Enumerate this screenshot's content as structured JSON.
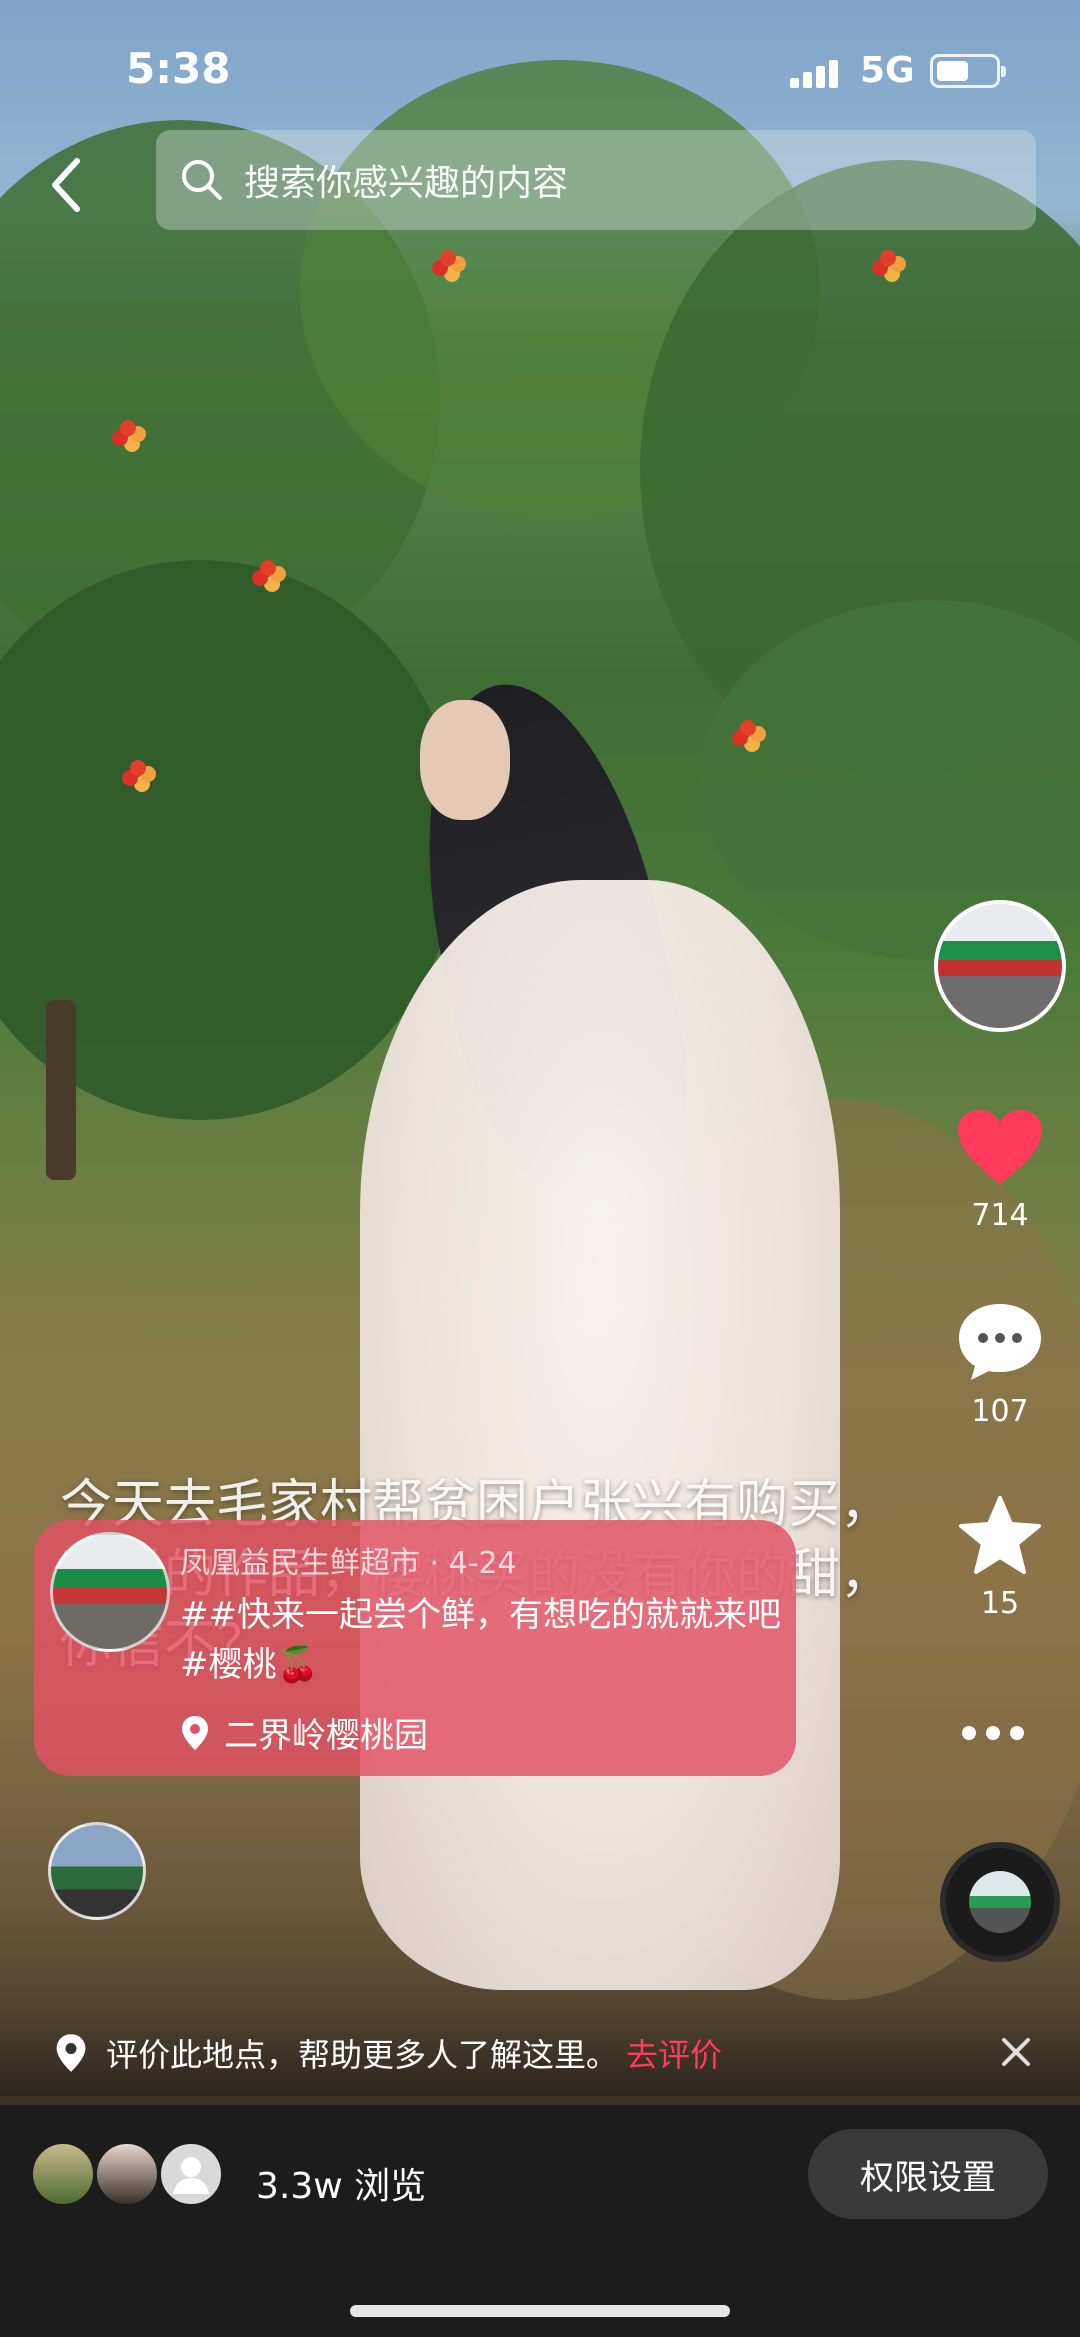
{
  "status_bar": {
    "time": "5:38",
    "network": "5G",
    "battery_level": 0.55,
    "signal_bars": 4
  },
  "search": {
    "placeholder": "搜索你感兴趣的内容",
    "icon": "search-icon"
  },
  "video": {
    "overlay_caption": "今天去毛家村帮贫困户张兴有购买，附赠的作品，樱桃买的没有你的甜，你信不？"
  },
  "card": {
    "author": "凤凰益民生鲜超市 · 4-24",
    "text": "##快来一起尝个鲜，有想吃的就就来吧 #樱桃🍒",
    "location": "二界岭樱桃园"
  },
  "actions": {
    "likes": "714",
    "comments": "107",
    "favorites": "15"
  },
  "review_prompt": {
    "text": "评价此地点，帮助更多人了解这里。",
    "link": "去评价"
  },
  "bottom": {
    "views": "3.3w 浏览",
    "permission_button": "权限设置"
  },
  "colors": {
    "like": "#ff3b5c",
    "card_bg": "#e25064",
    "bottom_bg": "#1c1c1c"
  }
}
